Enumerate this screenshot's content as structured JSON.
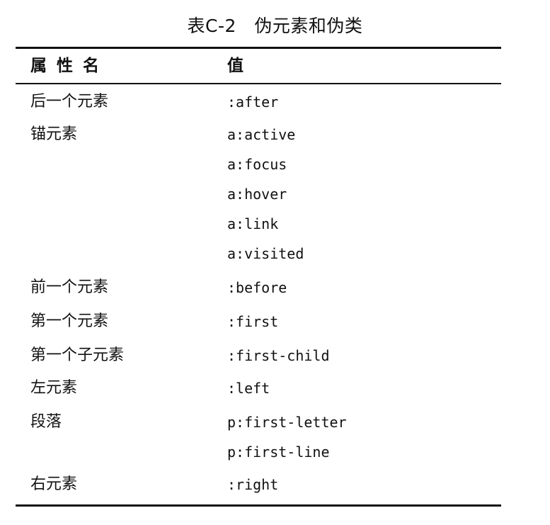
{
  "title": "表C-2　伪元素和伪类",
  "header": {
    "name": "属性名",
    "value": "值"
  },
  "rows": [
    {
      "name": "后一个元素",
      "values": [
        ":after"
      ]
    },
    {
      "name": "锚元素",
      "values": [
        "a:active",
        "a:focus",
        "a:hover",
        "a:link",
        "a:visited"
      ]
    },
    {
      "name": "前一个元素",
      "values": [
        ":before"
      ]
    },
    {
      "name": "第一个元素",
      "values": [
        ":first"
      ]
    },
    {
      "name": "第一个子元素",
      "values": [
        ":first-child"
      ]
    },
    {
      "name": "左元素",
      "values": [
        ":left"
      ]
    },
    {
      "name": "段落",
      "values": [
        "p:first-letter",
        "p:first-line"
      ]
    },
    {
      "name": "右元素",
      "values": [
        ":right"
      ]
    }
  ]
}
